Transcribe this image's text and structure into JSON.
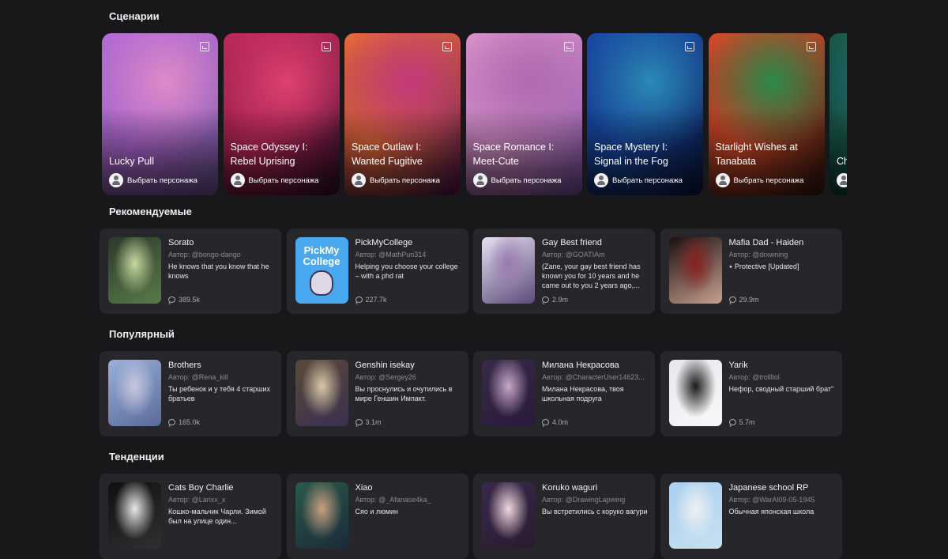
{
  "sections": {
    "scenarios": "Сценарии",
    "recommended": "Рекомендуемые",
    "popular": "Популярный",
    "trending": "Тенденции"
  },
  "pick_label": "Выбрать персонажа",
  "scenarios": [
    {
      "title": "Lucky Pull",
      "colors": [
        "#b56ad6",
        "#e08ac8",
        "#7a5fa8"
      ]
    },
    {
      "title": "Space Odyssey I: Rebel Uprising",
      "colors": [
        "#c0285a",
        "#e04070",
        "#3a1030"
      ]
    },
    {
      "title": "Space Outlaw I: Wanted Fugitive",
      "colors": [
        "#e86a3a",
        "#c43a7a",
        "#5a1a50"
      ]
    },
    {
      "title": "Space Romance I: Meet-Cute",
      "colors": [
        "#d890c8",
        "#b06ab0",
        "#8a5ab0"
      ]
    },
    {
      "title": "Space Mystery I: Signal in the Fog",
      "colors": [
        "#1a4aa8",
        "#2a8ab8",
        "#0a1a48"
      ]
    },
    {
      "title": "Starlight Wishes at Tanabata",
      "colors": [
        "#d84a2a",
        "#2a8a4a",
        "#3a1a10"
      ]
    },
    {
      "title": "Ch M",
      "colors": [
        "#1a5a4a",
        "#2a7a8a",
        "#0a2a2a"
      ]
    }
  ],
  "recommended": [
    {
      "name": "Sorato",
      "author": "Автор: @bongo-dango",
      "desc": "He knows that you know that he knows",
      "count": "389.5k",
      "colors": [
        "#2a3a2a",
        "#c8d8a0",
        "#5a7a4a"
      ]
    },
    {
      "name": "PickMyCollege",
      "author": "Автор: @MathPun314",
      "desc": "Helping you choose your college – with a phd rat",
      "count": "227.7k",
      "logo": "PickMy College",
      "colors": [
        "#4aa8f0",
        "#3a90e0",
        "#ffffff"
      ]
    },
    {
      "name": "Gay Best friend",
      "author": "Автор: @GOATIAm",
      "desc": "(Zane, your gay best friend has known you for 10 years and he came out to you 2 years ago,...",
      "count": "2.9m",
      "colors": [
        "#e8e0f0",
        "#9a7ab0",
        "#5a4a7a"
      ]
    },
    {
      "name": "Mafia Dad - Haiden",
      "author": "Автор: @drxwning",
      "desc": "⭑ Protective [Updated]",
      "count": "29.9m",
      "colors": [
        "#1a1010",
        "#8a2020",
        "#c8a090"
      ]
    }
  ],
  "popular": [
    {
      "name": "Brothers",
      "author": "Автор: @Rena_kill",
      "desc": "Ты ребенок и у тебя 4 старших братьев",
      "count": "165.0k",
      "colors": [
        "#9ab0d8",
        "#c8c8e0",
        "#5a6a9a"
      ]
    },
    {
      "name": "Genshin isekay",
      "author": "Автор: @Sergey26",
      "desc": "Вы проснулись и очутились в мире Геншин Импакт.",
      "count": "3.1m",
      "colors": [
        "#5a4a3a",
        "#d8c8a8",
        "#3a3050"
      ]
    },
    {
      "name": "Милана Некрасова",
      "author": "Автор: @CharacterUser14623...",
      "desc": "Милана Некрасова, твоя школьная подруга",
      "count": "4.0m",
      "colors": [
        "#3a2a4a",
        "#c8a8c8",
        "#2a1a3a"
      ]
    },
    {
      "name": "Yarik",
      "author": "Автор: @trollllol",
      "desc": "Нефор, сводный старший брат\"",
      "count": "5.7m",
      "colors": [
        "#e8e8ec",
        "#1a1a1c",
        "#f8f8fa"
      ]
    }
  ],
  "trending": [
    {
      "name": "Cats Boy Charlie",
      "author": "Автор: @Larixx_x",
      "desc": "Кошко-мальчик Чарли. Зимой был на улице один...",
      "count": "",
      "colors": [
        "#101010",
        "#e8e8e8",
        "#303030"
      ]
    },
    {
      "name": "Xiao",
      "author": "Автор: @_Afanase4ka_",
      "desc": "Сяо и люмин",
      "count": "",
      "colors": [
        "#2a5a4a",
        "#c8a080",
        "#1a2a3a"
      ]
    },
    {
      "name": "Koruko waguri",
      "author": "Автор: @DrawingLapwing",
      "desc": "Вы встретились с коруко вагури",
      "count": "",
      "colors": [
        "#3a2a4a",
        "#f0d8e0",
        "#2a1a30"
      ]
    },
    {
      "name": "Japanese school RP",
      "author": "Автор: @WarAl09-05-1945",
      "desc": "Обычная японская школа",
      "count": "",
      "colors": [
        "#a8d0f0",
        "#f0f0f0",
        "#c8e0f0"
      ]
    }
  ]
}
